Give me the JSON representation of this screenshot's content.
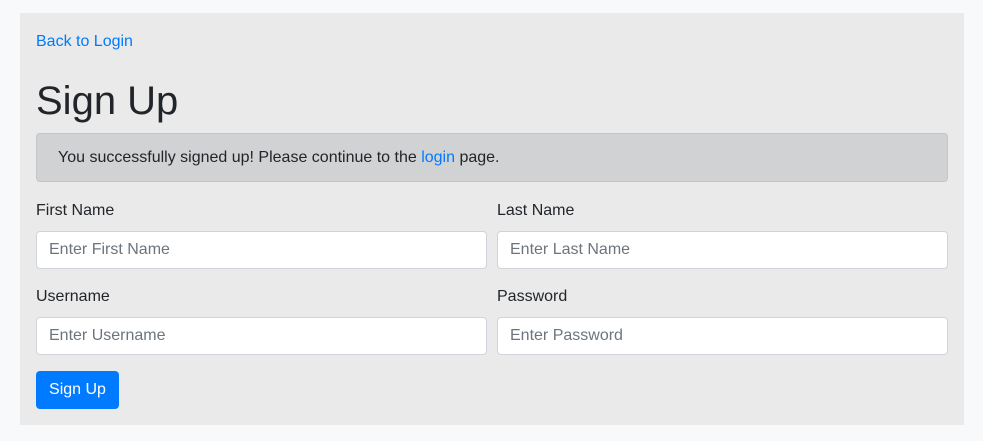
{
  "back_link": "Back to Login",
  "title": "Sign Up",
  "alert": {
    "before": "You successfully signed up! Please continue to the ",
    "link": "login",
    "after": " page."
  },
  "form": {
    "first_name": {
      "label": "First Name",
      "placeholder": "Enter First Name"
    },
    "last_name": {
      "label": "Last Name",
      "placeholder": "Enter Last Name"
    },
    "username": {
      "label": "Username",
      "placeholder": "Enter Username"
    },
    "password": {
      "label": "Password",
      "placeholder": "Enter Password"
    },
    "submit": "Sign Up"
  },
  "colors": {
    "accent": "#007bff",
    "alert_bg": "#d1d2d4",
    "panel_bg": "#eaeaea"
  }
}
